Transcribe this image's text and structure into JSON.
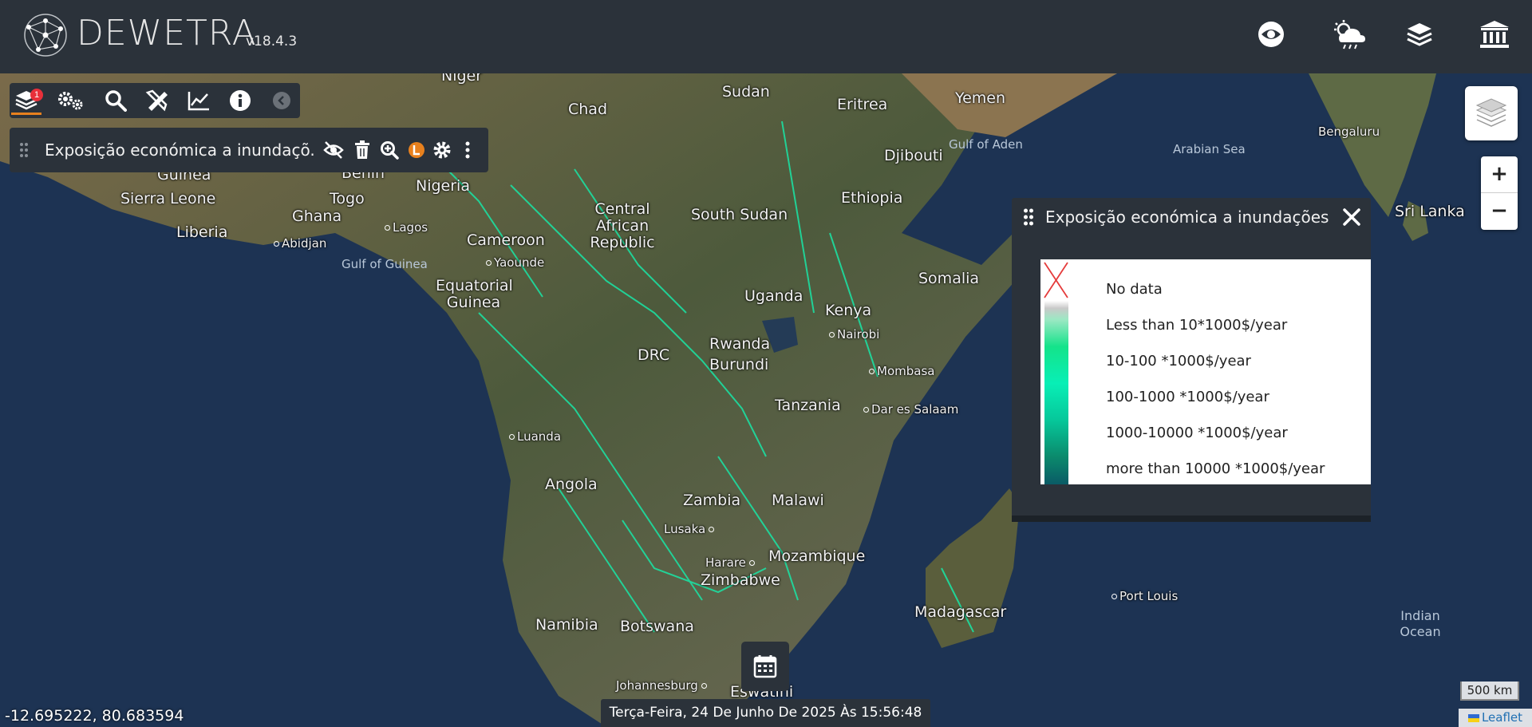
{
  "app": {
    "brand": "DEWETRA",
    "version": "v18.4.3"
  },
  "colors": {
    "panel": "#2b323a",
    "accent": "#e8811e",
    "badge": "#e8303a",
    "river": "#19e6a6"
  },
  "header_icons": [
    "eye-icon",
    "weather-icon",
    "layers-stack-icon",
    "institution-icon"
  ],
  "toolbar": {
    "badge_count": "1",
    "buttons": [
      "layers-icon",
      "settings-gears-icon",
      "search-icon",
      "tools-icon",
      "chart-line-icon",
      "info-icon",
      "collapse-icon"
    ]
  },
  "layer": {
    "title": "Exposição económica a inundaçõ..."
  },
  "legend": {
    "title": "Exposição económica a inundações",
    "items": [
      "No data",
      "Less than 10*1000$/year",
      "10-100 *1000$/year",
      "100-1000 *1000$/year",
      "1000-10000 *1000$/year",
      "more than 10000 *1000$/year"
    ]
  },
  "map": {
    "countries": [
      "Niger",
      "Chad",
      "Sudan",
      "Eritrea",
      "Yemen",
      "Djibouti",
      "Ethiopia",
      "South Sudan",
      "Central African Republic",
      "Cameroon",
      "Nigeria",
      "Benin",
      "Togo",
      "Ghana",
      "Sierra Leone",
      "Liberia",
      "Guinea",
      "Equatorial Guinea",
      "DRC",
      "Uganda",
      "Kenya",
      "Rwanda",
      "Burundi",
      "Tanzania",
      "Somalia",
      "Angola",
      "Zambia",
      "Malawi",
      "Mozambique",
      "Zimbabwe",
      "Namibia",
      "Botswana",
      "Madagascar",
      "Eswatini",
      "Sri Lanka"
    ],
    "cities": [
      "Abidjan",
      "Lagos",
      "Yaounde",
      "Nairobi",
      "Mombasa",
      "Dar es Salaam",
      "Luanda",
      "Lusaka",
      "Harare",
      "Johannesburg",
      "Port Louis",
      "Bengaluru"
    ],
    "seas": [
      "Gulf of Guinea",
      "Gulf of Aden",
      "Arabian Sea",
      "Indian Ocean"
    ],
    "coords": "-12.695222, 80.683594",
    "scale": "500 km",
    "attribution": "Leaflet",
    "date": "Terça-Feira, 24 De Junho De 2025 Às 15:56:48"
  }
}
